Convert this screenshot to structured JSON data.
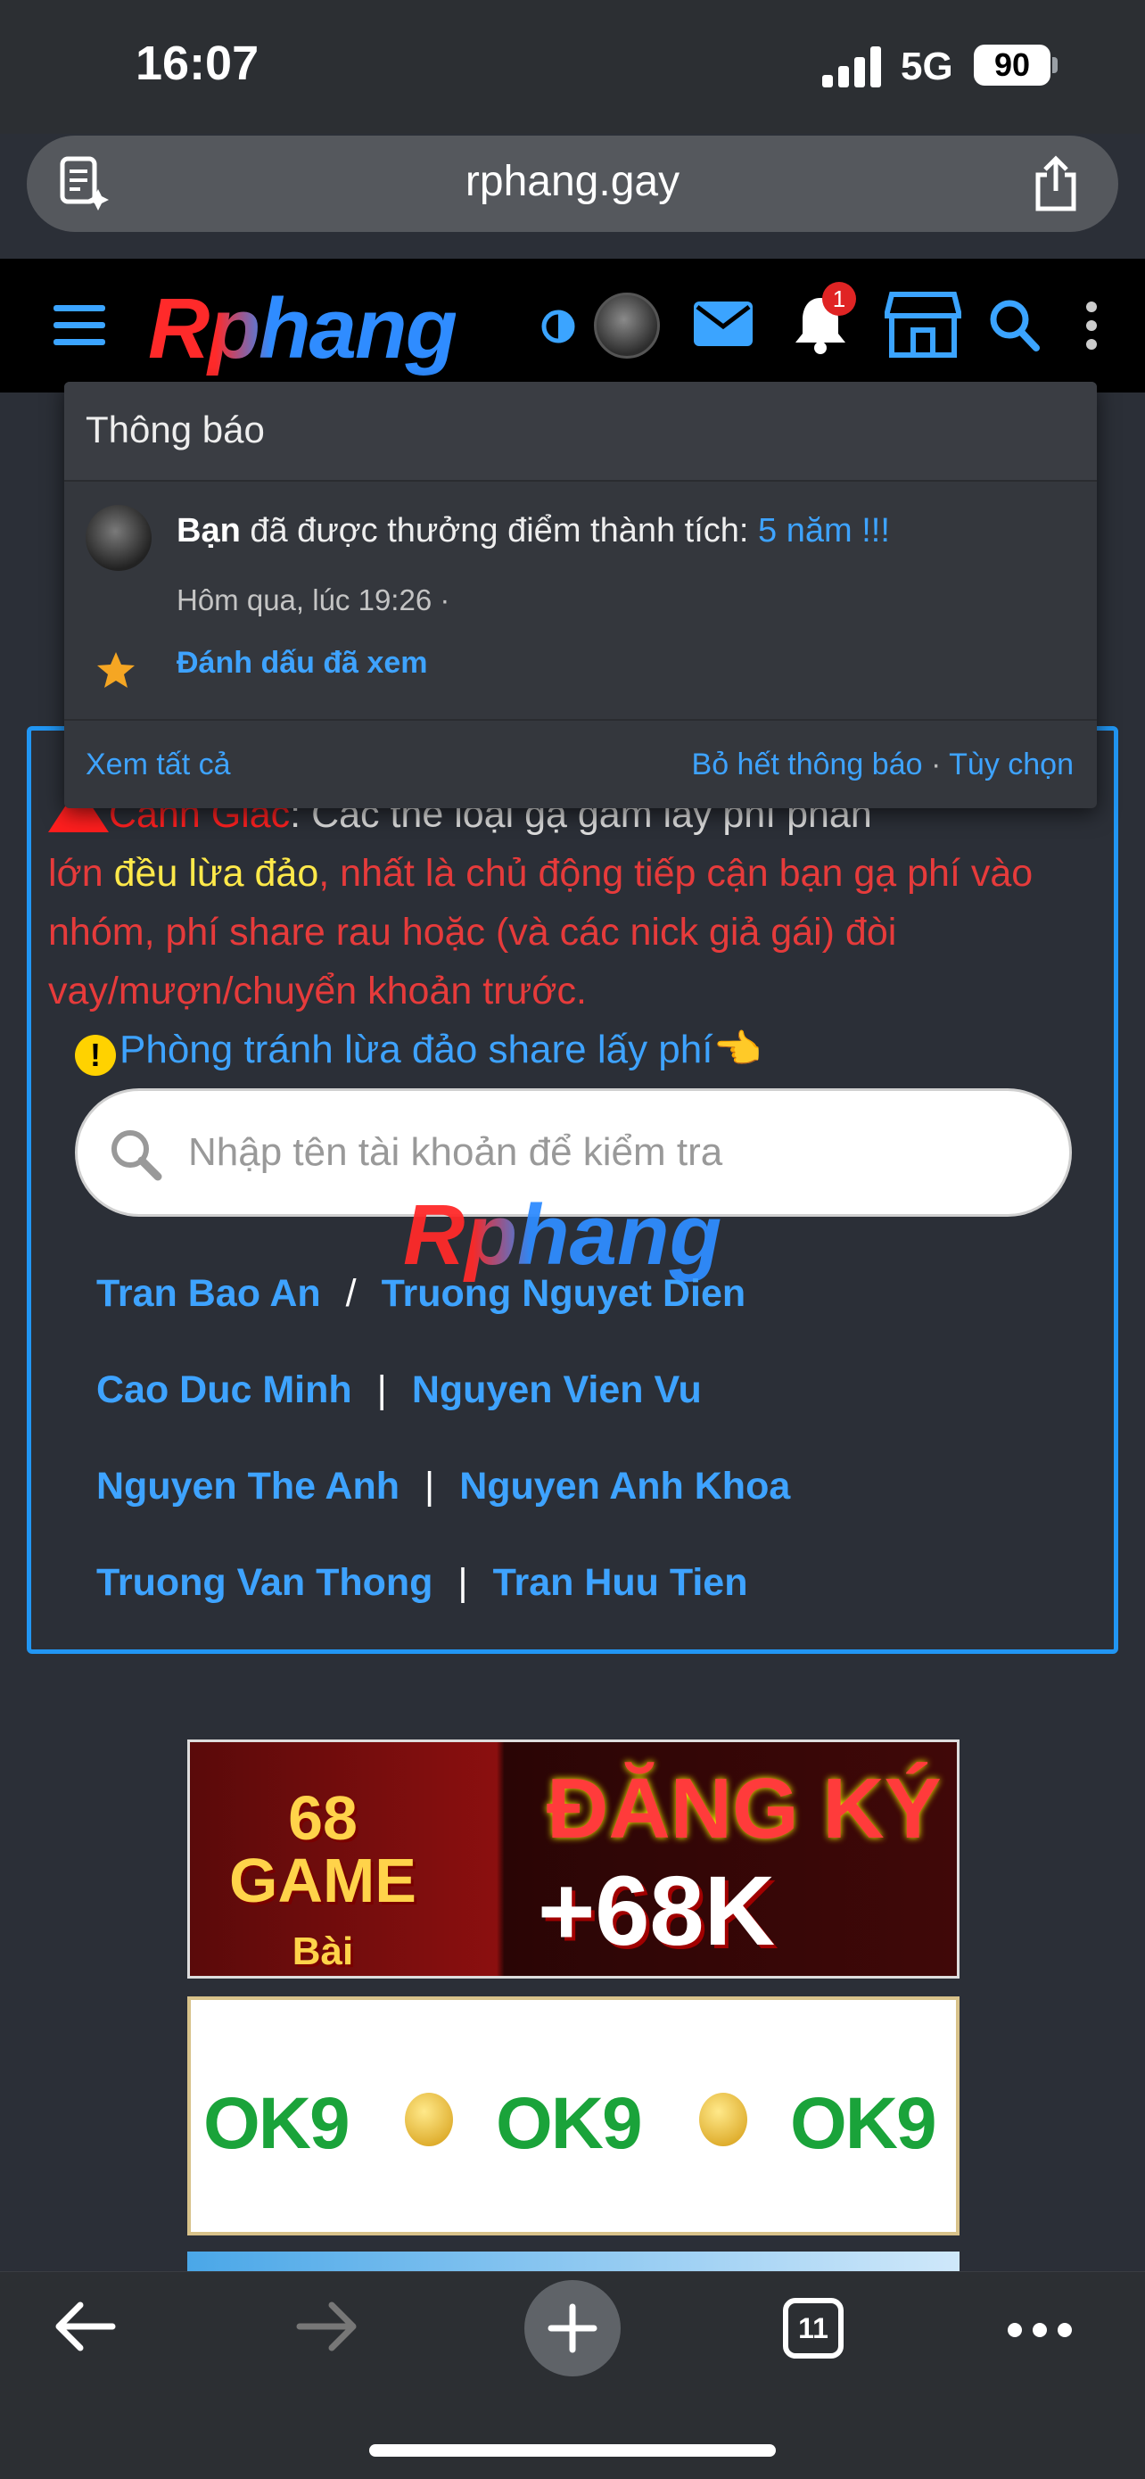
{
  "status": {
    "time": "16:07",
    "network": "5G",
    "battery": "90"
  },
  "browser": {
    "url": "rphang.gay",
    "tab_count": "11"
  },
  "site": {
    "logo": "Rphang",
    "notification_count": "1"
  },
  "notifications": {
    "title": "Thông báo",
    "item": {
      "actor": "Bạn",
      "message": " đã được thưởng điểm thành tích: ",
      "link_text": "5 năm !!!",
      "time": "Hôm qua, lúc 19:26 ·",
      "mark_read": "Đánh dấu đã xem"
    },
    "view_all": "Xem tất cả",
    "dismiss_all": "Bỏ hết thông báo",
    "options": "Tùy chọn"
  },
  "warning": {
    "title": "Cảnh Giác",
    "text1": ": Các thể loại gạ gẫm lấy phí phần",
    "text2": "lớn ",
    "highlight": "đều lừa đảo",
    "text3": ", nhất là chủ động tiếp cận bạn gạ phí vào nhóm, phí share rau hoặc (và các nick giả gái) đòi vay/mượn/chuyển khoản trước.",
    "prevent_link": "Phòng tránh lừa đảo share lấy phí👈"
  },
  "search": {
    "placeholder": "Nhập tên tài khoản để kiểm tra"
  },
  "watermark": "Rphang",
  "names": [
    [
      "Tran Bao An",
      "/",
      "Truong Nguyet Dien"
    ],
    [
      "Cao Duc Minh",
      "|",
      "Nguyen Vien Vu"
    ],
    [
      "Nguyen The Anh",
      "|",
      "Nguyen Anh Khoa"
    ],
    [
      "Truong Van Thong",
      "|",
      "Tran Huu Tien"
    ]
  ],
  "ads": {
    "ad1_left_line1": "68",
    "ad1_left_line2": "GAME",
    "ad1_left_line3": "Bài",
    "ad1_right_line1": "ĐĂNG KÝ",
    "ad1_right_line2": "+68K",
    "ad2_brand": "OK9"
  },
  "colors": {
    "accent": "#3ea3ff",
    "warning": "#e63b3b",
    "border": "#2196f3"
  }
}
